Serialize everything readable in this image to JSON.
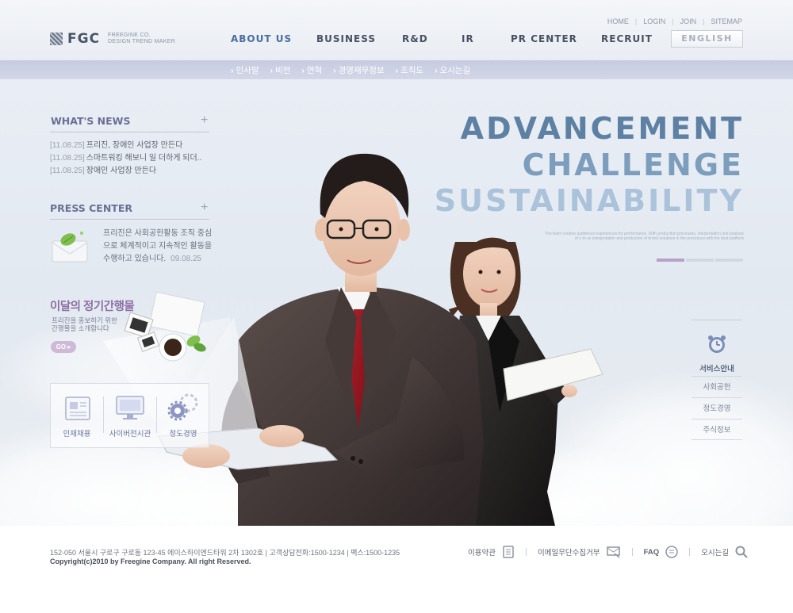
{
  "logo": {
    "name": "FGC",
    "tagline1": "FREEGINE CO.",
    "tagline2": "DESIGN TREND MAKER"
  },
  "utility": {
    "home": "HOME",
    "login": "LOGIN",
    "join": "JOIN",
    "sitemap": "SITEMAP"
  },
  "gnb": {
    "about": "ABOUT US",
    "business": "BUSINESS",
    "rnd": "R&D",
    "ir": "IR",
    "pr": "PR CENTER",
    "recruit": "RECRUIT",
    "english": "ENGLISH"
  },
  "subnav": [
    "인사말",
    "비전",
    "연혁",
    "경영재무정보",
    "조직도",
    "오시는길"
  ],
  "news": {
    "title": "WHAT'S NEWS",
    "items": [
      {
        "date": "[11.08.25]",
        "text": "프리진, 장애인 사업장 만든다"
      },
      {
        "date": "[11.08.25]",
        "text": "스마트워킹 해보니 일 더하게 되더.."
      },
      {
        "date": "[11.08.25]",
        "text": "장애인 사업장 만든다"
      }
    ]
  },
  "press": {
    "title": "PRESS CENTER",
    "text": "프리진은 사회공헌활동 조직 중심으로 체계적이고 지속적인 활동을 수행하고 있습니다.",
    "date": "09.08.25"
  },
  "promo": {
    "title": "이달의 정기간행물",
    "sub1": "프리진을 홍보하기 위한",
    "sub2": "간행물을 소개합니다",
    "go": "GO"
  },
  "quick": {
    "recruit": "인재채용",
    "cyber": "사이버전시관",
    "ethics": "정도경영"
  },
  "hero": {
    "line1": "ADVANCEMENT",
    "line2": "CHALLENGE",
    "line3": "SUSTAINABILITY",
    "small": "The team creates audiences experiences for performance. With production processes, interpretation and analysis of e to us interpretation and production of brand solutions in the processes with the best platform"
  },
  "service": {
    "title": "서비스안내",
    "items": [
      "사회공헌",
      "정도경영",
      "주식정보"
    ]
  },
  "footer": {
    "address": "152-050 서울시 구로구 구로동 123-45 에이스하이엔드타워 2차 1302호  |  고객상담전화:1500-1234  |  팩스:1500-1235",
    "copyright": "Copyright(c)2010 by Freegine Company. All right Reserved.",
    "terms": "이용약관",
    "email_policy": "이메일무단수집거부",
    "faq": "FAQ",
    "directions": "오시는길"
  },
  "colors": {
    "accent": "#4a6ea0",
    "purple": "#8b6fa3",
    "subnav": "#c8cde1"
  }
}
